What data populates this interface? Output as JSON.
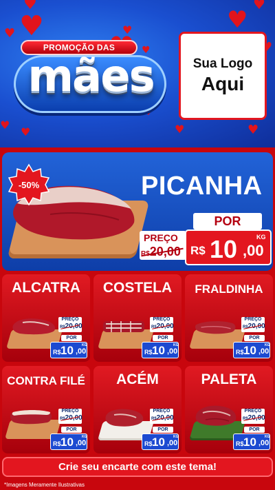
{
  "header": {
    "promo_line": "PROMOÇÃO DAS",
    "promo_word": "mães",
    "logo_line1": "Sua Logo",
    "logo_line2": "Aqui"
  },
  "featured": {
    "discount": "-50%",
    "name": "PICANHA",
    "por_label": "POR",
    "preco_label": "PREÇO",
    "old_currency": "R$",
    "old_price": "20,00",
    "currency": "R$",
    "price_int": "10",
    "price_dec": ",00",
    "unit": "KG"
  },
  "products": [
    {
      "name": "ALCATRA",
      "preco_label": "PREÇO",
      "old_currency": "R$",
      "old_price": "20,00",
      "por_label": "POR",
      "currency": "R$",
      "price_int": "10",
      "price_dec": ",00",
      "unit": "KG"
    },
    {
      "name": "COSTELA",
      "preco_label": "PREÇO",
      "old_currency": "R$",
      "old_price": "20,00",
      "por_label": "POR",
      "currency": "R$",
      "price_int": "10",
      "price_dec": ",00",
      "unit": "KG"
    },
    {
      "name": "FRALDINHA",
      "preco_label": "PREÇO",
      "old_currency": "R$",
      "old_price": "20,00",
      "por_label": "POR",
      "currency": "R$",
      "price_int": "10",
      "price_dec": ",00",
      "unit": "KG"
    },
    {
      "name": "CONTRA FILÉ",
      "preco_label": "PREÇO",
      "old_currency": "R$",
      "old_price": "20,00",
      "por_label": "POR",
      "currency": "R$",
      "price_int": "10",
      "price_dec": ",00",
      "unit": "KG"
    },
    {
      "name": "ACÉM",
      "preco_label": "PREÇO",
      "old_currency": "R$",
      "old_price": "20,00",
      "por_label": "POR",
      "currency": "R$",
      "price_int": "10",
      "price_dec": ",00",
      "unit": "KG"
    },
    {
      "name": "PALETA",
      "preco_label": "PREÇO",
      "old_currency": "R$",
      "old_price": "20,00",
      "por_label": "POR",
      "currency": "R$",
      "price_int": "10",
      "price_dec": ",00",
      "unit": "KG"
    }
  ],
  "cta": "Crie seu encarte com este tema!",
  "disclaimer": "*Imagens Meramente Ilustrativas",
  "colors": {
    "brand_red": "#e3161f",
    "brand_blue": "#1c4ad1",
    "header_blue": "#1a4fd0"
  }
}
